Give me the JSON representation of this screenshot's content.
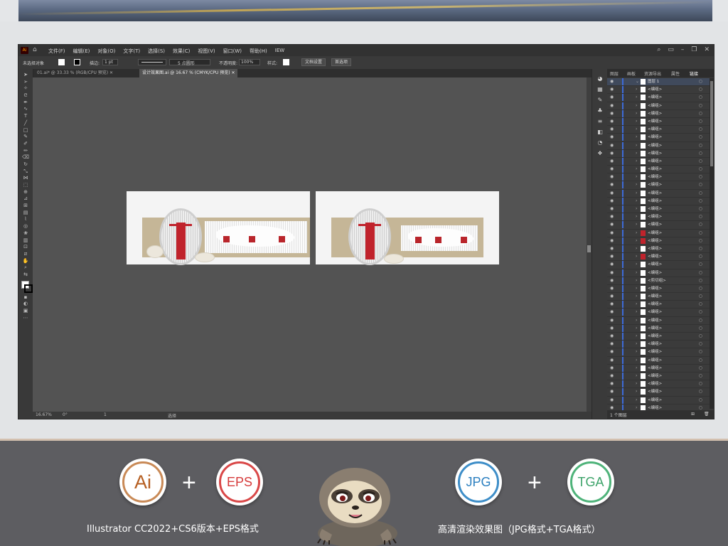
{
  "menubar": {
    "app_logo": "Ai",
    "menus": [
      "文件(F)",
      "编辑(E)",
      "对象(O)",
      "文字(T)",
      "选择(S)",
      "效果(C)",
      "视图(V)",
      "窗口(W)",
      "帮助(H)",
      "IEW"
    ]
  },
  "controlbar": {
    "selection_label": "未选择对象",
    "stroke_label": "描边:",
    "stroke_value": "1 pt",
    "brush_label": "5 点圆形",
    "opacity_label": "不透明度:",
    "opacity_value": "100%",
    "style_label": "样式:",
    "doc_setup_button": "文档设置",
    "prefs_button": "首选项"
  },
  "tabs": [
    {
      "label": "01.ai* @ 33.33 % (RGB/CPU 预览)",
      "active": false
    },
    {
      "label": "设计效果图.ai @ 16.67 % (CMYK/CPU 预览)",
      "active": true
    }
  ],
  "statusbar": {
    "zoom": "16.67%",
    "angle": "0°",
    "artboard": "1",
    "tool": "选择"
  },
  "layers_panel": {
    "tabs": [
      "图层",
      "画板",
      "资源导出",
      "属性",
      "链接"
    ],
    "top_layer": "图层 1",
    "rows": [
      {
        "name": "<编组>",
        "red": false
      },
      {
        "name": "<编组>",
        "red": false
      },
      {
        "name": "<编组>",
        "red": false
      },
      {
        "name": "<编组>",
        "red": false
      },
      {
        "name": "<编组>",
        "red": false
      },
      {
        "name": "<编组>",
        "red": false
      },
      {
        "name": "<编组>",
        "red": false
      },
      {
        "name": "<编组>",
        "red": false
      },
      {
        "name": "<编组>",
        "red": false
      },
      {
        "name": "<编组>",
        "red": false
      },
      {
        "name": "<编组>",
        "red": false
      },
      {
        "name": "<编组>",
        "red": false
      },
      {
        "name": "<编组>",
        "red": false
      },
      {
        "name": "<编组>",
        "red": false
      },
      {
        "name": "<编组>",
        "red": false
      },
      {
        "name": "<编组>",
        "red": false
      },
      {
        "name": "<编组>",
        "red": false
      },
      {
        "name": "<编组>",
        "red": false
      },
      {
        "name": "<编组>",
        "red": true
      },
      {
        "name": "<编组>",
        "red": true
      },
      {
        "name": "<编组>",
        "red": false
      },
      {
        "name": "<编组>",
        "red": true
      },
      {
        "name": "<编组>",
        "red": false
      },
      {
        "name": "<编组>",
        "red": false
      },
      {
        "name": "<剪切组>",
        "red": false
      },
      {
        "name": "<编组>",
        "red": false
      },
      {
        "name": "<编组>",
        "red": false
      },
      {
        "name": "<编组>",
        "red": false
      },
      {
        "name": "<编组>",
        "red": false
      },
      {
        "name": "<编组>",
        "red": false
      },
      {
        "name": "<编组>",
        "red": false
      },
      {
        "name": "<编组>",
        "red": false
      },
      {
        "name": "<编组>",
        "red": false
      },
      {
        "name": "<编组>",
        "red": false
      },
      {
        "name": "<编组>",
        "red": false
      },
      {
        "name": "<编组>",
        "red": false
      },
      {
        "name": "<编组>",
        "red": false
      },
      {
        "name": "<编组>",
        "red": false
      },
      {
        "name": "<编组>",
        "red": false
      },
      {
        "name": "<编组>",
        "red": false
      },
      {
        "name": "<编组>",
        "red": false
      },
      {
        "name": "<编组>",
        "red": false
      },
      {
        "name": "<编组>",
        "red": false
      },
      {
        "name": "<编组>",
        "red": false
      },
      {
        "name": "<编组>",
        "red": false
      }
    ],
    "footer": "1 个图层"
  },
  "formats": {
    "ai": "Ai",
    "eps": "EPS",
    "jpg": "JPG",
    "tga": "TGA",
    "plus": "+",
    "caption_left": "Illustrator CC2022+CS6版本+EPS格式",
    "caption_right": "高清渲染效果图（JPG格式+TGA格式）"
  },
  "colors": {
    "accent_blue": "#3d6bd8",
    "ai_orange": "#b65f22",
    "eps_red": "#d63a3a",
    "jpg_blue": "#2b7fc0",
    "tga_green": "#3fa46b",
    "design_red": "#c0232c",
    "design_tan": "#c5b697"
  }
}
